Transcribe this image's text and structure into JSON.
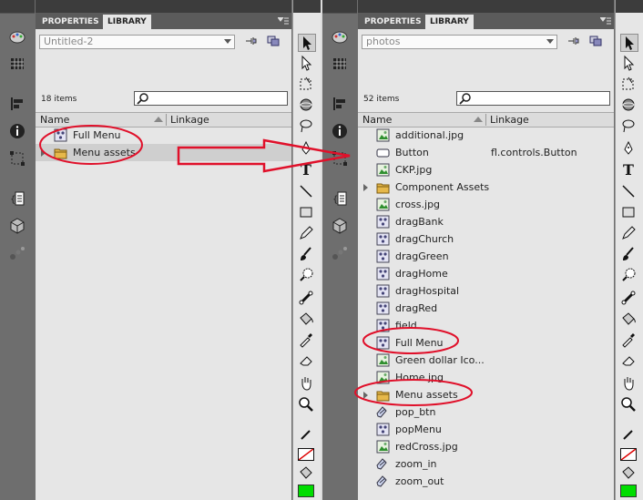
{
  "left": {
    "tabs": {
      "properties": "PROPERTIES",
      "library": "LIBRARY"
    },
    "document": "Untitled-2",
    "item_count": "18 items",
    "columns": {
      "name": "Name",
      "linkage": "Linkage"
    },
    "items": [
      {
        "name": "Full Menu",
        "icon": "movieclip-icon",
        "linkage": ""
      },
      {
        "name": "Menu assets",
        "icon": "folder-icon",
        "linkage": ""
      }
    ]
  },
  "right": {
    "tabs": {
      "properties": "PROPERTIES",
      "library": "LIBRARY"
    },
    "document": "photos",
    "item_count": "52 items",
    "columns": {
      "name": "Name",
      "linkage": "Linkage"
    },
    "items": [
      {
        "name": "additional.jpg",
        "icon": "bitmap-icon",
        "linkage": ""
      },
      {
        "name": "Button",
        "icon": "component-icon",
        "linkage": "fl.controls.Button"
      },
      {
        "name": "CKP.jpg",
        "icon": "bitmap-icon",
        "linkage": ""
      },
      {
        "name": "Component Assets",
        "icon": "folder-icon",
        "linkage": ""
      },
      {
        "name": "cross.jpg",
        "icon": "bitmap-icon",
        "linkage": ""
      },
      {
        "name": "dragBank",
        "icon": "movieclip-icon",
        "linkage": ""
      },
      {
        "name": "dragChurch",
        "icon": "movieclip-icon",
        "linkage": ""
      },
      {
        "name": "dragGreen",
        "icon": "movieclip-icon",
        "linkage": ""
      },
      {
        "name": "dragHome",
        "icon": "movieclip-icon",
        "linkage": ""
      },
      {
        "name": "dragHospital",
        "icon": "movieclip-icon",
        "linkage": ""
      },
      {
        "name": "dragRed",
        "icon": "movieclip-icon",
        "linkage": ""
      },
      {
        "name": "field",
        "icon": "movieclip-icon",
        "linkage": ""
      },
      {
        "name": "Full Menu",
        "icon": "movieclip-icon",
        "linkage": ""
      },
      {
        "name": "Green dollar Ico...",
        "icon": "bitmap-icon",
        "linkage": ""
      },
      {
        "name": "Home.jpg",
        "icon": "bitmap-icon",
        "linkage": ""
      },
      {
        "name": "Menu assets",
        "icon": "folder-icon",
        "linkage": ""
      },
      {
        "name": "pop_btn",
        "icon": "button-icon",
        "linkage": ""
      },
      {
        "name": "popMenu",
        "icon": "movieclip-icon",
        "linkage": ""
      },
      {
        "name": "redCross.jpg",
        "icon": "bitmap-icon",
        "linkage": ""
      },
      {
        "name": "zoom_in",
        "icon": "button-icon",
        "linkage": ""
      },
      {
        "name": "zoom_out",
        "icon": "button-icon",
        "linkage": ""
      }
    ]
  },
  "colors": {
    "annotation": "#e0102a",
    "fill_swatch": "#00dd00"
  }
}
